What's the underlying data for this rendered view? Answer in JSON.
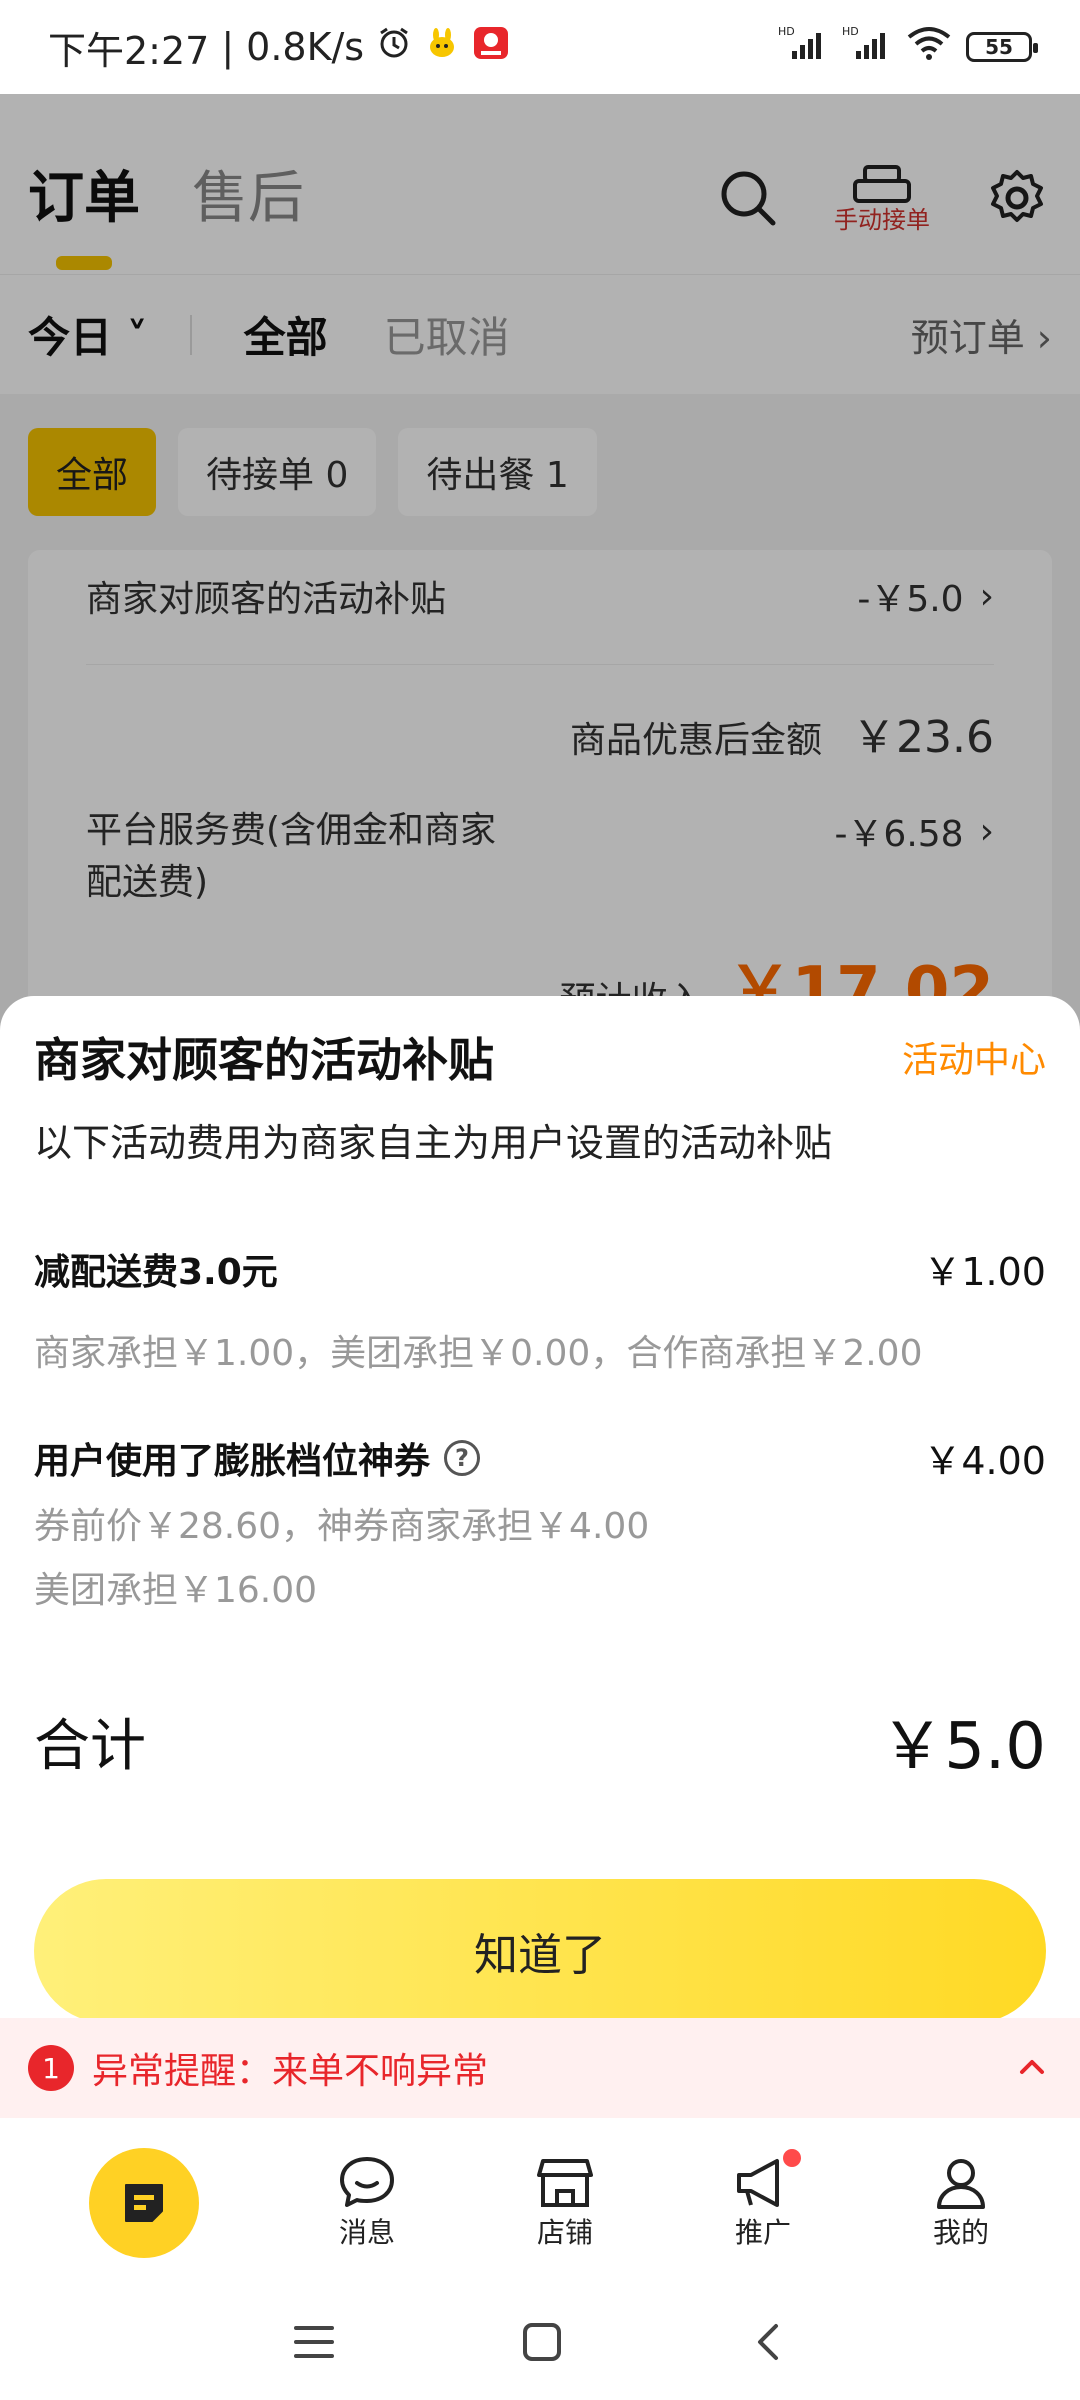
{
  "status": {
    "time": "下午2:27",
    "speed": "0.8K/s",
    "battery": "55"
  },
  "page": {
    "tabs": [
      "订单",
      "售后"
    ],
    "manual_order": "手动接单",
    "date_filter": "今日",
    "filter_tabs": [
      "全部",
      "已取消"
    ],
    "preorder": "预订单",
    "chips": [
      "全部",
      "待接单 0",
      "待出餐 1"
    ],
    "card": {
      "subsidy_label": "商家对顾客的活动补贴",
      "subsidy_amount": "-￥5.0",
      "subtotal_label": "商品优惠后金额",
      "subtotal_amount": "￥23.6",
      "service_label": "平台服务费(含佣金和商家配送费)",
      "service_amount": "-￥6.58",
      "income_label": "预计收入",
      "income_amount": "￥17.02"
    }
  },
  "sheet": {
    "title": "商家对顾客的活动补贴",
    "link": "活动中心",
    "desc": "以下活动费用为商家自主为用户设置的活动补贴",
    "items": [
      {
        "name": "减配送费3.0元",
        "price": "￥1.00",
        "detail": [
          "商家承担￥1.00，美团承担￥0.00，合作商承担￥2.00"
        ]
      },
      {
        "name": "用户使用了膨胀档位神券",
        "price": "￥4.00",
        "detail": [
          "券前价￥28.60，神券商家承担￥4.00",
          "美团承担￥16.00"
        ]
      }
    ],
    "total_label": "合计",
    "total_value": "￥5.0",
    "button": "知道了"
  },
  "alert": {
    "count": "1",
    "text": "异常提醒：来单不响异常"
  },
  "tabbar": {
    "items": [
      "消息",
      "店铺",
      "推广",
      "我的"
    ]
  },
  "colors": {
    "accent_yellow": "#ffd124",
    "orange": "#ff8a00",
    "alert_red": "#e8262b"
  }
}
